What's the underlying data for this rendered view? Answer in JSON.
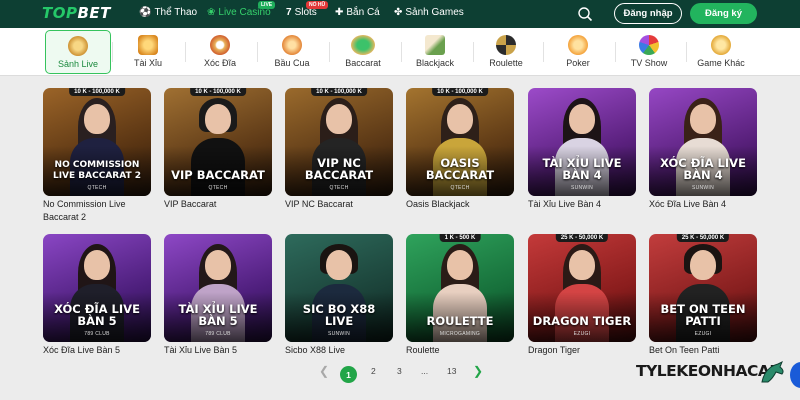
{
  "brand": {
    "logo_a": "TOP",
    "logo_b": "BET"
  },
  "nav": {
    "items": [
      {
        "label": "Thể Thao"
      },
      {
        "label": "Live Casino",
        "badge": "LIVE"
      },
      {
        "label": "Slots",
        "badge": "NỔ HŨ"
      },
      {
        "label": "Bắn Cá"
      },
      {
        "label": "Sảnh Games"
      }
    ],
    "login_label": "Đăng nhập",
    "register_label": "Đăng ký"
  },
  "categories": [
    {
      "label": "Sảnh Live",
      "icon": "crown-icon",
      "active": true
    },
    {
      "label": "Tài Xỉu",
      "icon": "dice-icon"
    },
    {
      "label": "Xóc Đĩa",
      "icon": "xoc-dia-icon"
    },
    {
      "label": "Bầu Cua",
      "icon": "gourd-icon"
    },
    {
      "label": "Baccarat",
      "icon": "baccarat-table-icon"
    },
    {
      "label": "Blackjack",
      "icon": "cards-icon"
    },
    {
      "label": "Roulette",
      "icon": "roulette-wheel-icon"
    },
    {
      "label": "Poker",
      "icon": "poker-chip-icon"
    },
    {
      "label": "TV Show",
      "icon": "tv-show-icon"
    },
    {
      "label": "Game Khác",
      "icon": "coins-icon"
    }
  ],
  "games": [
    {
      "title": "No Commission Live Baccarat 2",
      "card_name": "NO COMMISSION LIVE BACCARAT 2",
      "range": "10 K - 100,000 K",
      "provider": "QTECH"
    },
    {
      "title": "VIP Baccarat",
      "card_name": "VIP BACCARAT",
      "range": "10 K - 100,000 K",
      "provider": "QTECH"
    },
    {
      "title": "VIP NC Baccarat",
      "card_name": "VIP NC BACCARAT",
      "range": "10 K - 100,000 K",
      "provider": "QTECH"
    },
    {
      "title": "Oasis Blackjack",
      "card_name": "OASIS BACCARAT",
      "range": "10 K - 100,000 K",
      "provider": "QTECH"
    },
    {
      "title": "Tài Xỉu Live Bàn 4",
      "card_name": "TÀI XỈU LIVE BÀN 4",
      "range": "",
      "provider": "SUNWIN"
    },
    {
      "title": "Xóc Đĩa Live Bàn 4",
      "card_name": "XÓC ĐĨA LIVE BÀN 4",
      "range": "",
      "provider": "SUNWIN"
    },
    {
      "title": "Xóc Đĩa Live Bàn 5",
      "card_name": "XÓC ĐĨA LIVE BÀN 5",
      "range": "",
      "provider": "789 CLUB"
    },
    {
      "title": "Tài Xỉu Live Bàn 5",
      "card_name": "TÀI XỈU LIVE BÀN 5",
      "range": "",
      "provider": "789 CLUB"
    },
    {
      "title": "Sicbo X88 Live",
      "card_name": "SIC BO X88 LIVE",
      "range": "",
      "provider": "SUNWIN"
    },
    {
      "title": "Roulette",
      "card_name": "ROULETTE",
      "range": "1 K - 500 K",
      "provider": "MICROGAMING"
    },
    {
      "title": "Dragon Tiger",
      "card_name": "DRAGON TIGER",
      "range": "25 K - 50,000 K",
      "provider": "EZUGI"
    },
    {
      "title": "Bet On Teen Patti",
      "card_name": "BET ON TEEN PATTI",
      "range": "25 K - 50,000 K",
      "provider": "EZUGI"
    }
  ],
  "pagination": {
    "current": "1",
    "pages": [
      "2",
      "3",
      "...",
      "13"
    ]
  },
  "watermark": "TYLEKEONHACAI"
}
